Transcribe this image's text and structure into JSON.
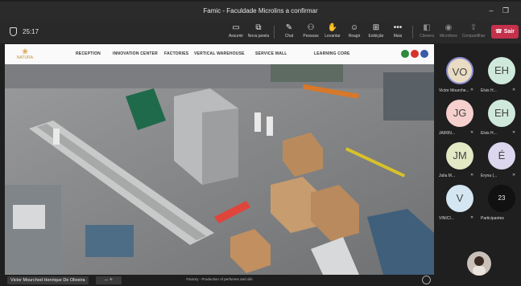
{
  "window": {
    "title": "Famic - Faculdade Microlins a confirmar",
    "min_glyph": "–",
    "max_glyph": "❐",
    "close_glyph": "✕"
  },
  "toolbar": {
    "timer": "25:17",
    "buttons": [
      {
        "label": "Assumir",
        "icon": "▭",
        "icon_name": "take-control-icon"
      },
      {
        "label": "Nova janela",
        "icon": "⧉",
        "icon_name": "new-window-icon"
      },
      {
        "label": "Chat",
        "icon": "✎",
        "icon_name": "chat-icon"
      },
      {
        "label": "Pessoas",
        "icon": "⚇",
        "icon_name": "people-icon"
      },
      {
        "label": "Levantar",
        "icon": "✋",
        "icon_name": "raise-hand-icon"
      },
      {
        "label": "Reagir",
        "icon": "☺",
        "icon_name": "react-icon"
      },
      {
        "label": "Exibição",
        "icon": "⊞",
        "icon_name": "view-icon"
      },
      {
        "label": "Mais",
        "icon": "•••",
        "icon_name": "more-icon"
      }
    ],
    "device_buttons": [
      {
        "label": "Câmera",
        "icon": "◧",
        "icon_name": "camera-icon"
      },
      {
        "label": "Microfone",
        "icon": "◉",
        "icon_name": "microphone-icon"
      },
      {
        "label": "Compartilhar",
        "icon": "⇪",
        "icon_name": "share-icon"
      }
    ],
    "leave_label": "Sair",
    "leave_icon": "☎"
  },
  "site": {
    "logo_text": "NATURA",
    "logo_mark": "❀",
    "nav": [
      "RECEPTION",
      "INNOVATION CENTER",
      "FACTORIES",
      "VERTICAL WAREHOUSE",
      "SERVICE MALL",
      "LEARNING CORE"
    ],
    "flag_colors": [
      "#2d8a3e",
      "#d9302c",
      "#3b5aa8"
    ]
  },
  "stage": {
    "presenter": "Victor Mourched Henrique De Oliveira",
    "zoom_controls": "–  +",
    "caption": "Factory - Production of perfumes and oils"
  },
  "participants": [
    {
      "initials": "VO",
      "name": "Victor Mourche...",
      "color": "#e9dcc2",
      "active": true
    },
    {
      "initials": "EH",
      "name": "Elvis H...",
      "color": "#cfe8dc"
    },
    {
      "initials": "JG",
      "name": "JAIRIN...",
      "color": "#f5d0cd"
    },
    {
      "initials": "EH",
      "name": "Elvis H...",
      "color": "#cfe8dc"
    },
    {
      "initials": "JM",
      "name": "Julia M...",
      "color": "#e3e8c5"
    },
    {
      "initials": "É",
      "name": "Éryna (...",
      "color": "#dcd6ee"
    },
    {
      "initials": "V",
      "name": "VINICI...",
      "color": "#d3e6f2"
    },
    {
      "initials": "23",
      "name": "Participantes",
      "color": "#111111",
      "count": true
    }
  ]
}
